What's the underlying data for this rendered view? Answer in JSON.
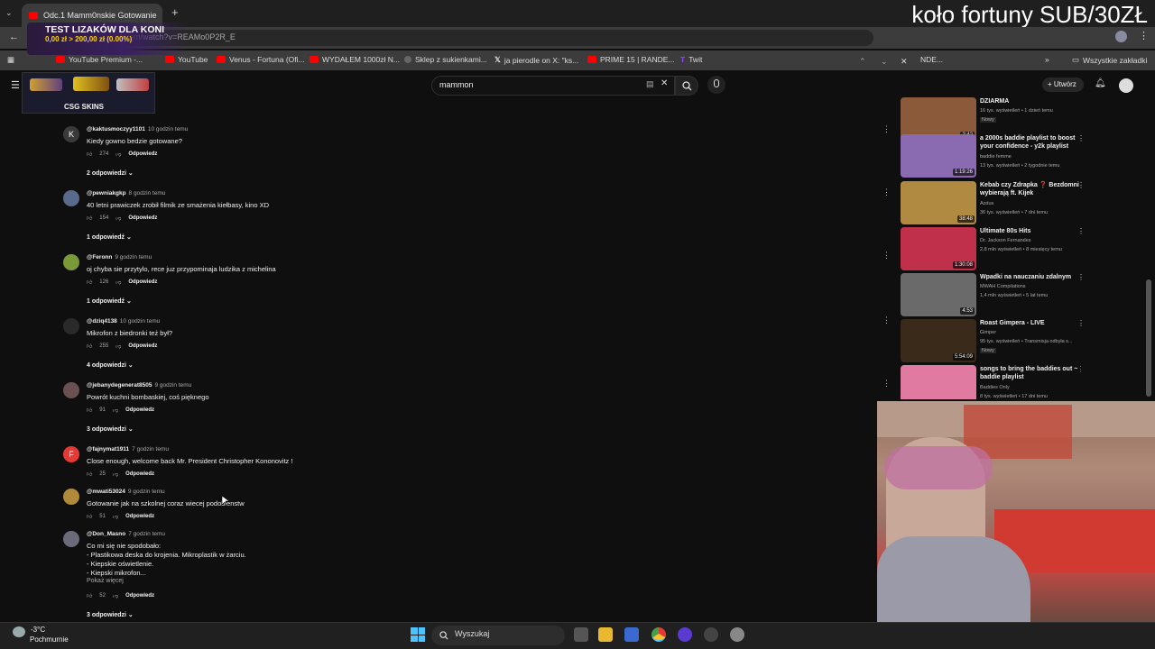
{
  "browser": {
    "tab_title": "Odc.1 Mamm0nskie Gotowanie",
    "url": "youtube.com/watch?v=REAMo0P2R_E",
    "bookmarks": [
      "YouTube Premium -...",
      "YouTube",
      "Venus - Fortuna (Ofi...",
      "WYDAŁEM 1000zł N...",
      "Sklep z sukienkami...",
      "ja pierodle on X: \"ks...",
      "PRIME 15 | RANDE...",
      "Twit",
      "NDE..."
    ],
    "all_bookmarks": "Wszystkie zakładki"
  },
  "stream_overlay": {
    "title": "koło fortuny SUB/30ZŁ",
    "lizak_title": "TEST LIZAKÓW DLA KONI",
    "lizak_progress": "0,00 zł > 200,00 zł (0.00%)",
    "sponsor": "CSG SKINS"
  },
  "youtube": {
    "search_value": "mammon",
    "create_label": "Utwórz",
    "comments": [
      {
        "avatar_letter": "K",
        "avatar_color": "#3a3a3a",
        "author": "@kaktusmoczyy1101",
        "time": "10 godzin temu",
        "text": "Kiedy gowno bedzie gotowane?",
        "likes": "274",
        "reply": "Odpowiedz",
        "replies": "2 odpowiedzi"
      },
      {
        "avatar_letter": "",
        "avatar_color": "#5a6a8a",
        "author": "@pewniakgkp",
        "time": "8 godzin temu",
        "text": "40 letni prawiczek zrobił filmik ze smażenia kiełbasy, kino XD",
        "likes": "154",
        "reply": "Odpowiedz",
        "replies": "1 odpowiedź"
      },
      {
        "avatar_letter": "",
        "avatar_color": "#7a9a3a",
        "author": "@Feronn",
        "time": "9 godzin temu",
        "text": "oj chyba sie przytylo, rece juz przypominaja ludzika z michelina",
        "likes": "126",
        "reply": "Odpowiedz",
        "replies": "1 odpowiedź"
      },
      {
        "avatar_letter": "",
        "avatar_color": "#2a2a2a",
        "author": "@dziq4138",
        "time": "10 godzin temu",
        "text": "Mikrofon z biedronki też był?",
        "likes": "255",
        "reply": "Odpowiedz",
        "replies": "4 odpowiedzi"
      },
      {
        "avatar_letter": "",
        "avatar_color": "#6a5050",
        "author": "@jebanydegenerat8505",
        "time": "9 godzin temu",
        "text": "Powrót kuchni bombaskiej, coś pięknego",
        "likes": "91",
        "reply": "Odpowiedz",
        "replies": "3 odpowiedzi"
      },
      {
        "avatar_letter": "F",
        "avatar_color": "#e53935",
        "author": "@fajnymat1911",
        "time": "7 godzin temu",
        "text": "Close enough, welcome back Mr. President Christopher Kononovitz !",
        "likes": "25",
        "reply": "Odpowiedz",
        "replies": ""
      },
      {
        "avatar_letter": "",
        "avatar_color": "#b08a3a",
        "author": "@mwati53024",
        "time": "9 godzin temu",
        "text": "Gotowanie jak na szkolnej coraz wiecej podobienstw",
        "likes": "51",
        "reply": "Odpowiedz",
        "replies": ""
      },
      {
        "avatar_letter": "",
        "avatar_color": "#6a6a7a",
        "author": "@Don_Masno",
        "time": "7 godzin temu",
        "text": "Co mi się nie spodobało:\n- Plastikowa deska do krojenia. Mikroplastik w żarciu.\n- Kiepskie oświetlenie.\n- Kiepski mikrofon...",
        "more": "Pokaż więcej",
        "likes": "52",
        "reply": "Odpowiedz",
        "replies": "3 odpowiedzi"
      }
    ],
    "recommended": [
      {
        "title": "DZIARMA",
        "channel": "",
        "meta": "16 tys. wyświetleń • 1 dzień temu",
        "badge": "Nowy",
        "duration": "2:42",
        "color": "#8a5a3a"
      },
      {
        "title": "a 2000s baddie playlist to boost your confidence - y2k playlist",
        "channel": "baddie femme",
        "meta": "13 tys. wyświetleń • 2 tygodnie temu",
        "badge": "",
        "duration": "1:19:26",
        "color": "#8a6ab0"
      },
      {
        "title": "Kebab czy Zdrapka ❓ Bezdomni wybierają ft. Kijek",
        "channel": "Azdus",
        "meta": "36 tys. wyświetleń • 7 dni temu",
        "badge": "",
        "duration": "38:48",
        "color": "#b08a40"
      },
      {
        "title": "Ultimate 80s Hits",
        "channel": "Dr. Jackson Fernandes",
        "meta": "2,8 mln wyświetleń • 8 miesięcy temu",
        "badge": "",
        "duration": "1:30:08",
        "color": "#c0304a"
      },
      {
        "title": "Wpadki na nauczaniu zdalnym",
        "channel": "MWAH Compilations",
        "meta": "1,4 mln wyświetleń • 5 lat temu",
        "badge": "",
        "duration": "4:53",
        "color": "#6a6a6a"
      },
      {
        "title": "Roast Gimpera - LIVE",
        "channel": "Gimper",
        "meta": "95 tys. wyświetleń • Transmisja odbyła s...",
        "badge": "Nowy",
        "duration": "5:54:09",
        "color": "#3a2a1a"
      },
      {
        "title": "songs to bring the baddies out ~ baddie playlist",
        "channel": "Baddies Only",
        "meta": "8 tys. wyświetleń • 17 dni temu",
        "badge": "",
        "duration": "",
        "color": "#e07aa0"
      }
    ]
  },
  "taskbar": {
    "weather_temp": "-3°C",
    "weather_desc": "Pochmurnie",
    "search_label": "Wyszukaj"
  }
}
